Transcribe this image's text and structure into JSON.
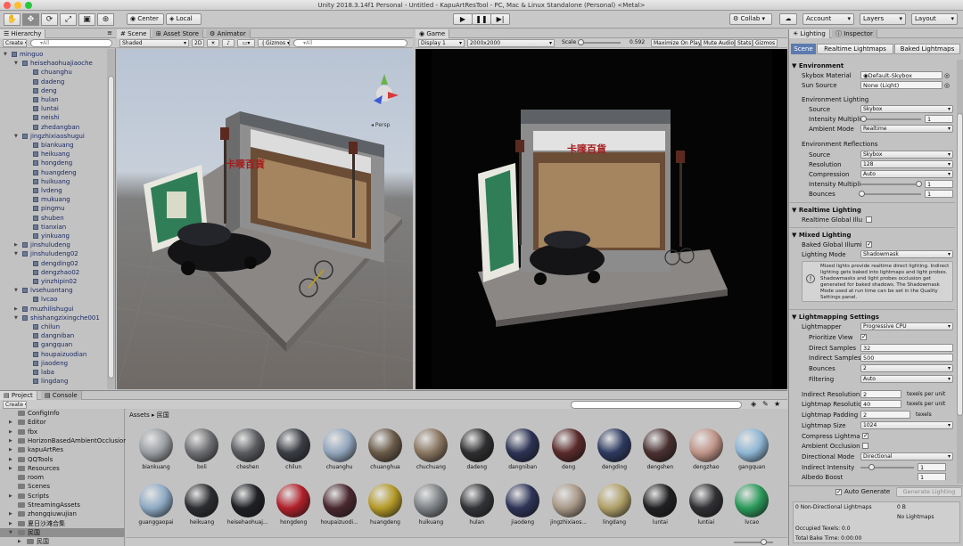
{
  "window": {
    "title": "Unity 2018.3.14f1 Personal - Untitled - KapuArtResTool - PC, Mac & Linux Standalone (Personal) <Metal>"
  },
  "toolbar": {
    "center": "Center",
    "local": "Local",
    "collab": "Collab ▾",
    "account": "Account",
    "layers": "Layers",
    "layout": "Layout",
    "play_icon": "play-icon",
    "pause_icon": "pause-icon",
    "step_icon": "step-icon"
  },
  "hierarchy": {
    "tab": "Hierarchy",
    "create": "Create ▾",
    "search_placeholder": "▾All",
    "rows": [
      {
        "label": "minguo",
        "depth": 0,
        "expanded": true
      },
      {
        "label": "heisehaohuajiaoche",
        "depth": 1,
        "expanded": true
      },
      {
        "label": "chuanghu",
        "depth": 2
      },
      {
        "label": "dadeng",
        "depth": 2
      },
      {
        "label": "deng",
        "depth": 2
      },
      {
        "label": "hulan",
        "depth": 2
      },
      {
        "label": "luntai",
        "depth": 2
      },
      {
        "label": "neishi",
        "depth": 2
      },
      {
        "label": "zhedangban",
        "depth": 2
      },
      {
        "label": "jingzhixiaoshugui",
        "depth": 1,
        "expanded": true
      },
      {
        "label": "biankuang",
        "depth": 2
      },
      {
        "label": "heikuang",
        "depth": 2
      },
      {
        "label": "hongdeng",
        "depth": 2
      },
      {
        "label": "huangdeng",
        "depth": 2
      },
      {
        "label": "huikuang",
        "depth": 2
      },
      {
        "label": "lvdeng",
        "depth": 2
      },
      {
        "label": "mukuang",
        "depth": 2
      },
      {
        "label": "pingmu",
        "depth": 2
      },
      {
        "label": "shuben",
        "depth": 2
      },
      {
        "label": "tianxian",
        "depth": 2
      },
      {
        "label": "yinkuang",
        "depth": 2
      },
      {
        "label": "jinshuludeng",
        "depth": 1,
        "collapsed": true
      },
      {
        "label": "jinshuludeng02",
        "depth": 1,
        "expanded": true
      },
      {
        "label": "dengding02",
        "depth": 2
      },
      {
        "label": "dengzhao02",
        "depth": 2
      },
      {
        "label": "yinzhipin02",
        "depth": 2
      },
      {
        "label": "lvsehuantang",
        "depth": 1,
        "expanded": true
      },
      {
        "label": "lvcao",
        "depth": 2
      },
      {
        "label": "muzhilishugui",
        "depth": 1,
        "collapsed": true
      },
      {
        "label": "shishangzixingche001",
        "depth": 1,
        "expanded": true
      },
      {
        "label": "chilun",
        "depth": 2
      },
      {
        "label": "dangniban",
        "depth": 2
      },
      {
        "label": "gangquan",
        "depth": 2
      },
      {
        "label": "houpaizuodian",
        "depth": 2
      },
      {
        "label": "jiaodeng",
        "depth": 2
      },
      {
        "label": "laba",
        "depth": 2
      },
      {
        "label": "lingdang",
        "depth": 2
      }
    ]
  },
  "scene": {
    "tabs": [
      "Scene",
      "Asset Store",
      "Animator"
    ],
    "shading": "Shaded",
    "mode2d": "2D",
    "gizmos": "Gizmos ▾",
    "search_placeholder": "▾All",
    "persp": "◂ Persp",
    "sign": "卡嘜百貨"
  },
  "game": {
    "tab": "Game",
    "display": "Display 1",
    "resolution": "2000x2000",
    "scale_label": "Scale",
    "scale_value": "0.592",
    "buttons": [
      "Maximize On Play",
      "Mute Audio",
      "Stats",
      "Gizmos ▾"
    ]
  },
  "project": {
    "tabs": [
      "Project",
      "Console"
    ],
    "create": "Create ▾",
    "breadcrumb": [
      "Assets",
      "民国"
    ],
    "folders": [
      {
        "label": "ConfigInfo",
        "depth": 1
      },
      {
        "label": "Editor",
        "depth": 1,
        "arrow": true
      },
      {
        "label": "fbx",
        "depth": 1,
        "arrow": true
      },
      {
        "label": "HorizonBasedAmbientOcclusion",
        "depth": 1,
        "arrow": true
      },
      {
        "label": "kapuArtRes",
        "depth": 1,
        "arrow": true
      },
      {
        "label": "QQTools",
        "depth": 1,
        "arrow": true
      },
      {
        "label": "Resources",
        "depth": 1,
        "arrow": true
      },
      {
        "label": "room",
        "depth": 1
      },
      {
        "label": "Scenes",
        "depth": 1
      },
      {
        "label": "Scripts",
        "depth": 1,
        "arrow": true
      },
      {
        "label": "StreamingAssets",
        "depth": 1
      },
      {
        "label": "zhongqiuwujian",
        "depth": 1,
        "arrow": true
      },
      {
        "label": "夏日沙滩合集",
        "depth": 1,
        "arrow": true
      },
      {
        "label": "民国",
        "depth": 1,
        "expanded": true,
        "selected": true
      },
      {
        "label": "民国",
        "depth": 2,
        "arrow": true
      }
    ],
    "assets": [
      {
        "name": "biankuang",
        "color": "#9a9ea2"
      },
      {
        "name": "boli",
        "color": "#6e6f72"
      },
      {
        "name": "cheshen",
        "color": "#5a5c60"
      },
      {
        "name": "chilun",
        "color": "#3a3d44"
      },
      {
        "name": "chuanghu",
        "color": "#93a6bd"
      },
      {
        "name": "chuanghua",
        "color": "#6a5a48"
      },
      {
        "name": "chuchuang",
        "color": "#8a7660"
      },
      {
        "name": "dadeng",
        "color": "#2e2e30"
      },
      {
        "name": "dangniban",
        "color": "#2c3354"
      },
      {
        "name": "deng",
        "color": "#5a2a2a"
      },
      {
        "name": "dengding",
        "color": "#2d3a60"
      },
      {
        "name": "dengshen",
        "color": "#4a3030"
      },
      {
        "name": "dengzhao",
        "color": "#c09488"
      },
      {
        "name": "gangquan",
        "color": "#8fb6d4"
      },
      {
        "name": "guanggaopai",
        "color": "#8eaac4"
      },
      {
        "name": "heikuang",
        "color": "#2c2d30"
      },
      {
        "name": "heisehaohuaj...",
        "color": "#1e2024"
      },
      {
        "name": "hongdeng",
        "color": "#b0202a"
      },
      {
        "name": "houpaizuodi...",
        "color": "#4a2830"
      },
      {
        "name": "huangdeng",
        "color": "#b49a28"
      },
      {
        "name": "huikuang",
        "color": "#7e8286"
      },
      {
        "name": "hulan",
        "color": "#333438"
      },
      {
        "name": "jiaodeng",
        "color": "#2e3458"
      },
      {
        "name": "jingzhixiaos...",
        "color": "#a89888"
      },
      {
        "name": "lingdang",
        "color": "#b0a068"
      },
      {
        "name": "luntai",
        "color": "#202022"
      },
      {
        "name": "luntiai",
        "color": "#303034"
      },
      {
        "name": "lvcao",
        "color": "#2a9a5a"
      }
    ]
  },
  "lighting": {
    "tabs": [
      "Lighting",
      "Inspector"
    ],
    "subtabs": [
      "Scene",
      "Realtime Lightmaps",
      "Baked Lightmaps"
    ],
    "environment": {
      "header": "Environment",
      "skybox_label": "Skybox Material",
      "skybox_value": "Default-Skybox",
      "sun_label": "Sun Source",
      "sun_value": "None (Light)",
      "env_lighting": "Environment Lighting",
      "source_label": "Source",
      "source_value": "Skybox",
      "intensity_label": "Intensity Multipli",
      "intensity_value": "1",
      "intensity_fraction": 0.05,
      "ambient_label": "Ambient Mode",
      "ambient_value": "Realtime",
      "env_reflections": "Environment Reflections",
      "ref_source_label": "Source",
      "ref_source_value": "Skybox",
      "resolution_label": "Resolution",
      "resolution_value": "128",
      "compression_label": "Compression",
      "compression_value": "Auto",
      "ref_intensity_label": "Intensity Multipli",
      "ref_intensity_value": "1",
      "ref_intensity_fraction": 0.95,
      "bounces_label": "Bounces",
      "bounces_value": "1",
      "bounces_fraction": 0.02
    },
    "realtime": {
      "header": "Realtime Lighting",
      "gi_label": "Realtime Global Illu"
    },
    "mixed": {
      "header": "Mixed Lighting",
      "baked_gi_label": "Baked Global Illumi",
      "mode_label": "Lighting Mode",
      "mode_value": "Shadowmask",
      "info": "Mixed lights provide realtime direct lighting. Indirect lighting gets baked into lightmaps and light probes. Shadowmasks and light probes occlusion get generated for baked shadows. The Shadowmask Mode used at run time can be set in the Quality Settings panel."
    },
    "lightmapping": {
      "header": "Lightmapping Settings",
      "lightmapper_label": "Lightmapper",
      "lightmapper_value": "Progressive CPU",
      "prioritize_label": "Prioritize View",
      "direct_label": "Direct Samples",
      "direct_value": "32",
      "indirect_label": "Indirect Samples",
      "indirect_value": "500",
      "bounces_label": "Bounces",
      "bounces_value": "2",
      "filtering_label": "Filtering",
      "filtering_value": "Auto",
      "indirect_res_label": "Indirect Resolution",
      "indirect_res_value": "2",
      "indirect_res_unit": "texels per unit",
      "lightmap_res_label": "Lightmap Resolutio",
      "lightmap_res_value": "40",
      "lightmap_res_unit": "texels per unit",
      "padding_label": "Lightmap Padding",
      "padding_value": "2",
      "padding_unit": "texels",
      "size_label": "Lightmap Size",
      "size_value": "1024",
      "compress_label": "Compress Lightma",
      "ao_label": "Ambient Occlusion",
      "directional_label": "Directional Mode",
      "directional_value": "Directional",
      "indirect_int_label": "Indirect Intensity",
      "indirect_int_value": "1",
      "indirect_int_fraction": 0.2,
      "albedo_label": "Albedo Boost",
      "albedo_value": "1"
    },
    "footer": {
      "auto_generate": "Auto Generate",
      "generate_button": "Generate Lighting",
      "nondir_label": "0 Non-Directional Lightmaps",
      "nondir_size": "0 B",
      "no_lightmaps": "No Lightmaps",
      "occupied": "Occupied Texels: 0.0",
      "bake_time": "Total Bake Time: 0:00:00"
    }
  }
}
